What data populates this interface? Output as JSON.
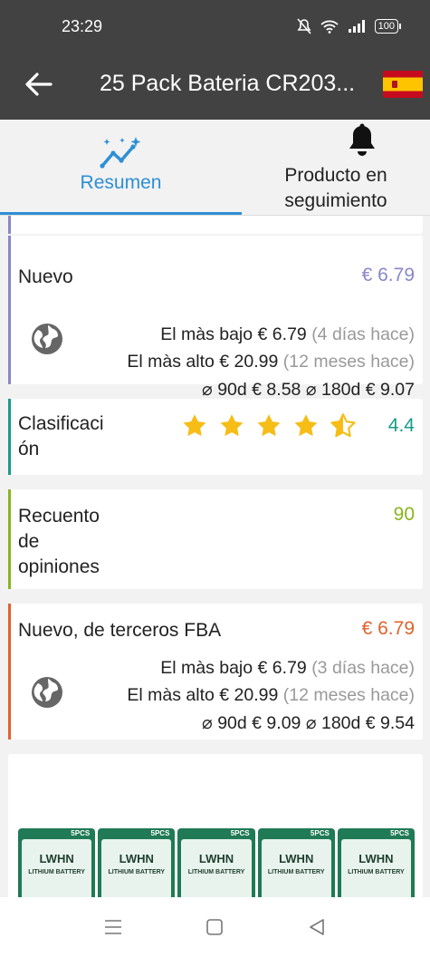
{
  "status": {
    "time": "23:29",
    "battery": "100"
  },
  "app_bar": {
    "title": "25 Pack Bateria CR203..."
  },
  "tabs": [
    {
      "label": "Resumen"
    },
    {
      "label_line1": "Producto en",
      "label_line2": "seguimiento"
    }
  ],
  "cards": {
    "nuevo": {
      "name": "Nuevo",
      "price": "€ 6.79",
      "lowest_label": "El màs bajo",
      "lowest_price": "€ 6.79",
      "lowest_when": "(4 días hace)",
      "highest_label": "El màs alto",
      "highest_price": "€ 20.99",
      "highest_when": "(12 meses hace)",
      "avg90_label": "⌀ 90d",
      "avg90": "€ 8.58",
      "avg180_label": "⌀ 180d",
      "avg180": "€ 9.07"
    },
    "rating": {
      "name_line1": "Clasificaci",
      "name_line2": "ón",
      "value": "4.4",
      "stars": 4.4
    },
    "reviews": {
      "name_line1": "Recuento",
      "name_line2": "de",
      "name_line3": "opiniones",
      "value": "90"
    },
    "fba": {
      "name": "Nuevo, de terceros FBA",
      "price": "€ 6.79",
      "lowest_label": "El màs bajo",
      "lowest_price": "€ 6.79",
      "lowest_when": "(3 días hace)",
      "highest_label": "El màs alto",
      "highest_price": "€ 20.99",
      "highest_when": "(12 meses hace)",
      "avg90_label": "⌀ 90d",
      "avg90": "€ 9.09",
      "avg180_label": "⌀ 180d",
      "avg180": "€ 9.54"
    }
  },
  "product_image": {
    "brand": "LWHN",
    "type": "LITHIUM BATTERY",
    "pack": "5PCS"
  },
  "colors": {
    "nuevo_accent": "#8a86c9",
    "rating_accent": "#1a9a8a",
    "reviews_accent": "#8ab41e",
    "fba_accent": "#e0622e",
    "tab_active": "#2d8fd5",
    "star": "#f6bd16"
  }
}
